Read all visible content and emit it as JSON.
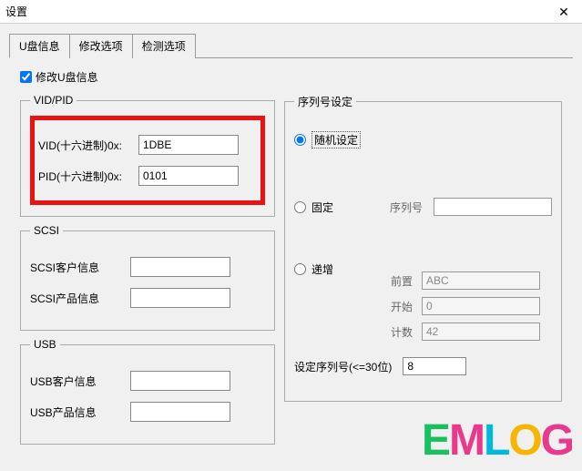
{
  "window": {
    "title": "设置",
    "close": "✕"
  },
  "tabs": {
    "t0": "U盘信息",
    "t1": "修改选项",
    "t2": "检测选项"
  },
  "checkbox": {
    "label": "修改U盘信息"
  },
  "vidpid": {
    "legend": "VID/PID",
    "vid_label": "VID(十六进制)0x:",
    "vid_value": "1DBE",
    "pid_label": "PID(十六进制)0x:",
    "pid_value": "0101"
  },
  "scsi": {
    "legend": "SCSI",
    "cust_label": "SCSI客户信息",
    "cust_value": "",
    "prod_label": "SCSI产品信息",
    "prod_value": ""
  },
  "usb": {
    "legend": "USB",
    "cust_label": "USB客户信息",
    "cust_value": "",
    "prod_label": "USB产品信息",
    "prod_value": ""
  },
  "serial": {
    "legend": "序列号设定",
    "random": "随机设定",
    "fixed": "固定",
    "fixed_label": "序列号",
    "fixed_value": "",
    "incr": "递增",
    "prefix_label": "前置",
    "prefix_value": "ABC",
    "start_label": "开始",
    "start_value": "0",
    "count_label": "计数",
    "count_value": "42",
    "seq_label": "设定序列号(<=30位)",
    "seq_value": "8"
  },
  "logo": {
    "e1": "E",
    "m": "M",
    "l": "L",
    "o": "O",
    "g": "G"
  }
}
